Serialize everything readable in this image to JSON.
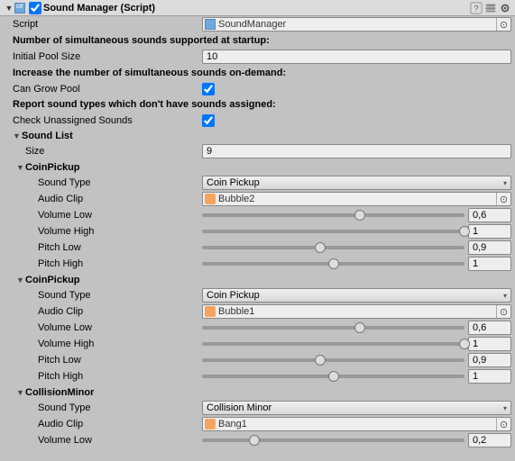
{
  "header": {
    "title": "Sound Manager (Script)"
  },
  "script": {
    "label": "Script",
    "value": "SoundManager"
  },
  "section1": {
    "heading": "Number of simultaneous sounds supported at startup:",
    "poolSizeLabel": "Initial Pool Size",
    "poolSizeValue": "10"
  },
  "section2": {
    "heading": "Increase the number of simultaneous sounds on-demand:",
    "canGrowLabel": "Can Grow Pool"
  },
  "section3": {
    "heading": "Report sound types which don't have sounds assigned:",
    "checkUnassignedLabel": "Check Unassigned Sounds"
  },
  "soundList": {
    "label": "Sound List",
    "sizeLabel": "Size",
    "sizeValue": "9",
    "fieldLabels": {
      "soundType": "Sound Type",
      "audioClip": "Audio Clip",
      "volumeLow": "Volume Low",
      "volumeHigh": "Volume High",
      "pitchLow": "Pitch Low",
      "pitchHigh": "Pitch High"
    },
    "items": [
      {
        "name": "CoinPickup",
        "soundType": "Coin Pickup",
        "audioClip": "Bubble2",
        "volumeLow": {
          "value": "0,6",
          "pct": 60
        },
        "volumeHigh": {
          "value": "1",
          "pct": 100
        },
        "pitchLow": {
          "value": "0,9",
          "pct": 45
        },
        "pitchHigh": {
          "value": "1",
          "pct": 50
        }
      },
      {
        "name": "CoinPickup",
        "soundType": "Coin Pickup",
        "audioClip": "Bubble1",
        "volumeLow": {
          "value": "0,6",
          "pct": 60
        },
        "volumeHigh": {
          "value": "1",
          "pct": 100
        },
        "pitchLow": {
          "value": "0,9",
          "pct": 45
        },
        "pitchHigh": {
          "value": "1",
          "pct": 50
        }
      },
      {
        "name": "CollisionMinor",
        "soundType": "Collision Minor",
        "audioClip": "Bang1",
        "volumeLow": {
          "value": "0,2",
          "pct": 20
        }
      }
    ]
  }
}
